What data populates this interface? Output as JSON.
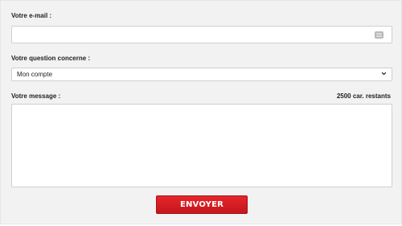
{
  "form": {
    "email_label": "Votre e-mail :",
    "email_value": "",
    "email_field_icon": "keyboard-icon",
    "question_label": "Votre question concerne :",
    "question_selected": "Mon compte",
    "question_dropdown_icon": "chevron-down-icon",
    "message_label": "Votre message :",
    "message_counter": "2500 car. restants",
    "message_value": "",
    "submit_label": "ENVOYER"
  },
  "colors": {
    "panel_background": "#f2f2f2",
    "submit_button": "#d71e24",
    "submit_text": "#ffffff"
  }
}
